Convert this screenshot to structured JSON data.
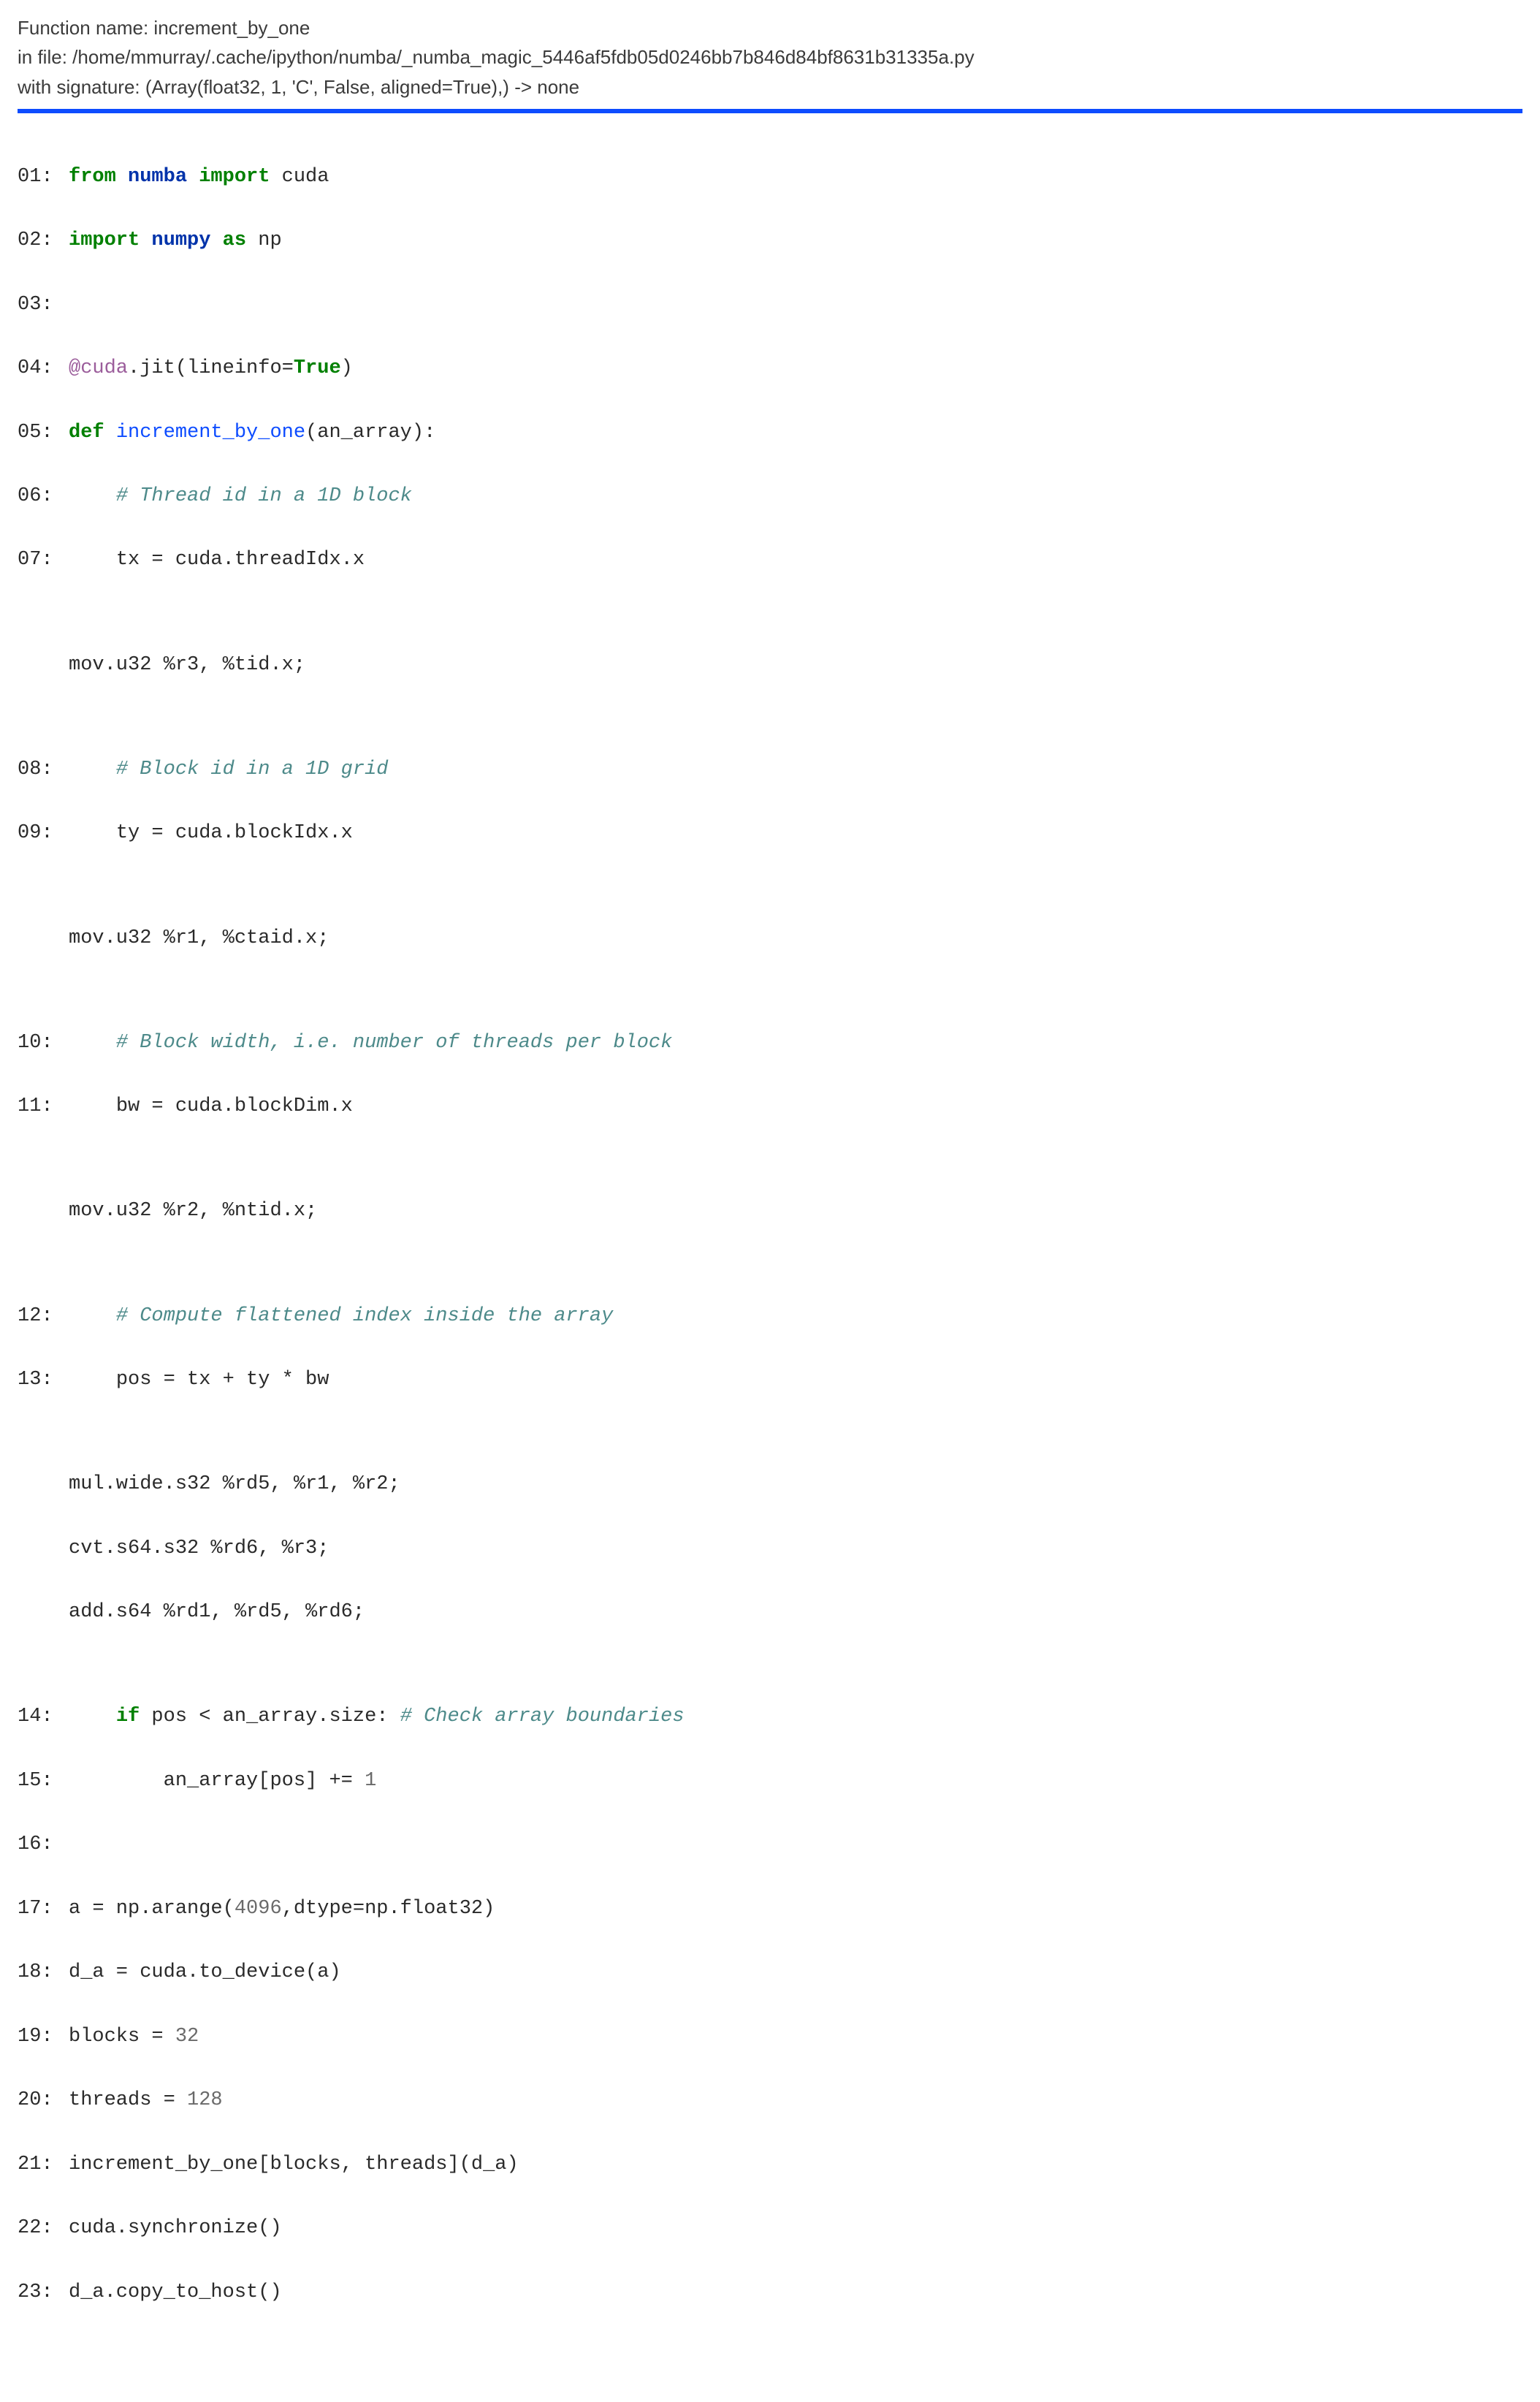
{
  "header": {
    "line1": "Function name: increment_by_one",
    "line2": "in file: /home/mmurray/.cache/ipython/numba/_numba_magic_5446af5fdb05d0246bb7b846d84bf8631b31335a.py",
    "line3": "with signature: (Array(float32, 1, 'C', False, aligned=True),) -> none"
  },
  "lines": {
    "l01": {
      "ln": "01:",
      "from": "from",
      "numba": "numba",
      "import": "import",
      "cuda": " cuda"
    },
    "l02": {
      "ln": "02:",
      "import": "import",
      "numpy": "numpy",
      "as": "as",
      "np": " np"
    },
    "l03": {
      "ln": "03:"
    },
    "l04": {
      "ln": "04:",
      "dec": "@cuda",
      "rest1": ".jit(lineinfo=",
      "true": "True",
      "rest2": ")"
    },
    "l05": {
      "ln": "05:",
      "def": "def",
      "func": "increment_by_one",
      "rest": "(an_array):"
    },
    "l06": {
      "ln": "06:",
      "comment": "# Thread id in a 1D block"
    },
    "l07": {
      "ln": "07:",
      "code": "tx = cuda.threadIdx.x"
    },
    "a07": {
      "asm": "mov.u32 %r3, %tid.x;"
    },
    "l08": {
      "ln": "08:",
      "comment": "# Block id in a 1D grid"
    },
    "l09": {
      "ln": "09:",
      "code": "ty = cuda.blockIdx.x"
    },
    "a09": {
      "asm": "mov.u32 %r1, %ctaid.x;"
    },
    "l10": {
      "ln": "10:",
      "comment": "# Block width, i.e. number of threads per block"
    },
    "l11": {
      "ln": "11:",
      "code": "bw = cuda.blockDim.x"
    },
    "a11": {
      "asm": "mov.u32 %r2, %ntid.x;"
    },
    "l12": {
      "ln": "12:",
      "comment": "# Compute flattened index inside the array"
    },
    "l13": {
      "ln": "13:",
      "code": "pos = tx + ty * bw"
    },
    "a13a": {
      "asm": "mul.wide.s32 %rd5, %r1, %r2;"
    },
    "a13b": {
      "asm": "cvt.s64.s32 %rd6, %r3;"
    },
    "a13c": {
      "asm": "add.s64 %rd1, %rd5, %rd6;"
    },
    "l14": {
      "ln": "14:",
      "if": "if",
      "cond": " pos < an_array.size: ",
      "comment": "# Check array boundaries"
    },
    "l15": {
      "ln": "15:",
      "code": "an_array[pos] += ",
      "one": "1"
    },
    "l16": {
      "ln": "16:"
    },
    "l17": {
      "ln": "17:",
      "pre": "a = np.arange(",
      "n1": "4096",
      "mid": ",dtype=np.float32)"
    },
    "l18": {
      "ln": "18:",
      "code": "d_a = cuda.to_device(a)"
    },
    "l19": {
      "ln": "19:",
      "pre": "blocks = ",
      "n": "32"
    },
    "l20": {
      "ln": "20:",
      "pre": "threads = ",
      "n": "128"
    },
    "l21": {
      "ln": "21:",
      "code": "increment_by_one[blocks, threads](d_a)"
    },
    "l22": {
      "ln": "22:",
      "code": "cuda.synchronize()"
    },
    "l23": {
      "ln": "23:",
      "code": "d_a.copy_to_host()"
    }
  }
}
